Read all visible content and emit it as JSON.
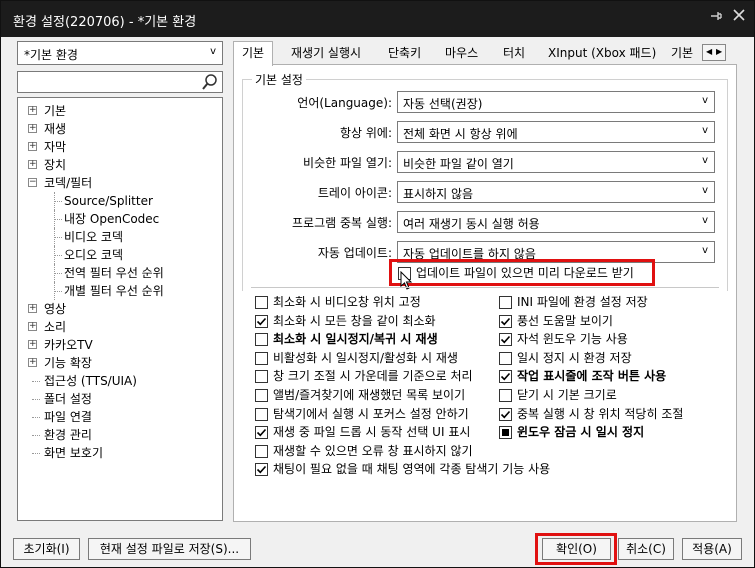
{
  "window": {
    "title": "환경 설정(220706) - *기본 환경",
    "pin_icon": "pin-icon",
    "close_icon": "close-icon"
  },
  "left": {
    "profile_combo": "*기본 환경",
    "search_placeholder": "",
    "tree": [
      {
        "label": "기본",
        "type": "expandable"
      },
      {
        "label": "재생",
        "type": "expandable"
      },
      {
        "label": "자막",
        "type": "expandable"
      },
      {
        "label": "장치",
        "type": "expandable"
      },
      {
        "label": "코덱/필터",
        "type": "expanded"
      },
      {
        "label": "Source/Splitter",
        "type": "child"
      },
      {
        "label": "내장 OpenCodec",
        "type": "child"
      },
      {
        "label": "비디오 코덱",
        "type": "child"
      },
      {
        "label": "오디오 코덱",
        "type": "child"
      },
      {
        "label": "전역 필터 우선 순위",
        "type": "child"
      },
      {
        "label": "개별 필터 우선 순위",
        "type": "child"
      },
      {
        "label": "영상",
        "type": "expandable"
      },
      {
        "label": "소리",
        "type": "expandable"
      },
      {
        "label": "카카오TV",
        "type": "expandable"
      },
      {
        "label": "기능 확장",
        "type": "expandable"
      },
      {
        "label": "접근성 (TTS/UIA)",
        "type": "plain"
      },
      {
        "label": "폴더 설정",
        "type": "plain"
      },
      {
        "label": "파일 연결",
        "type": "plain"
      },
      {
        "label": "환경 관리",
        "type": "plain"
      },
      {
        "label": "화면 보호기",
        "type": "plain"
      }
    ]
  },
  "tabs": [
    "기본",
    "재생기 실행시",
    "단축키",
    "마우스",
    "터치",
    "XInput (Xbox 패드)",
    "기본 :"
  ],
  "group_title": "기본 설정",
  "settings": [
    {
      "label": "언어(Language):",
      "value": "자동 선택(권장)"
    },
    {
      "label": "항상 위에:",
      "value": "전체 화면 시 항상 위에"
    },
    {
      "label": "비슷한 파일 열기:",
      "value": "비슷한 파일 같이 열기"
    },
    {
      "label": "트레이 아이콘:",
      "value": "표시하지 않음"
    },
    {
      "label": "프로그램 중복 실행:",
      "value": "여러 재생기 동시 실행 허용"
    },
    {
      "label": "자동 업데이트:",
      "value": "자동 업데이트를 하지 않음"
    }
  ],
  "update_prefetch": {
    "label": "업데이트 파일이 있으면 미리 다운로드 받기",
    "checked": false
  },
  "checkboxes_left": [
    {
      "label": "최소화 시 비디오창 위치 고정",
      "checked": false,
      "bold": false
    },
    {
      "label": "최소화 시 모든 창을 같이 최소화",
      "checked": true,
      "bold": false
    },
    {
      "label": "최소화 시 일시정지/복귀 시 재생",
      "checked": false,
      "bold": true
    },
    {
      "label": "비활성화 시 일시정지/활성화 시 재생",
      "checked": false,
      "bold": false
    },
    {
      "label": "창 크기 조절 시 가운데를 기준으로 처리",
      "checked": false,
      "bold": false
    },
    {
      "label": "앨범/즐겨찾기에 재생했던 목록 보이기",
      "checked": false,
      "bold": false
    },
    {
      "label": "탐색기에서 실행 시 포커스 설정 안하기",
      "checked": false,
      "bold": false
    },
    {
      "label": "재생 중 파일 드롭 시 동작 선택 UI 표시",
      "checked": true,
      "bold": false
    },
    {
      "label": "재생할 수 있으면 오류 창 표시하지 않기",
      "checked": false,
      "bold": false
    },
    {
      "label": "채팅이 필요 없을 때 채팅 영역에 각종 탐색기 기능 사용",
      "checked": true,
      "bold": false
    }
  ],
  "checkboxes_right": [
    {
      "label": "INI 파일에 환경 설정 저장",
      "checked": false,
      "bold": false
    },
    {
      "label": "풍선 도움말 보이기",
      "checked": true,
      "bold": false
    },
    {
      "label": "자석 윈도우 기능 사용",
      "checked": true,
      "bold": false
    },
    {
      "label": "일시 정지 시 환경 저장",
      "checked": false,
      "bold": false
    },
    {
      "label": "작업 표시줄에 조작 버튼 사용",
      "checked": true,
      "bold": true
    },
    {
      "label": "닫기 시 기본 크기로",
      "checked": false,
      "bold": false
    },
    {
      "label": "중복 실행 시 창 위치 적당히 조절",
      "checked": true,
      "bold": false
    },
    {
      "label": "윈도우 잠금 시 일시 정지",
      "checked": "partial",
      "bold": true
    }
  ],
  "buttons": {
    "reset": "초기화(I)",
    "save_current": "현재 설정 파일로 저장(S)...",
    "ok": "확인(O)",
    "cancel": "취소(C)",
    "apply": "적용(A)"
  },
  "colors": {
    "titlebar": "#1c1c1c",
    "highlight": "#e01010",
    "window_bg": "#f0f0f0"
  }
}
